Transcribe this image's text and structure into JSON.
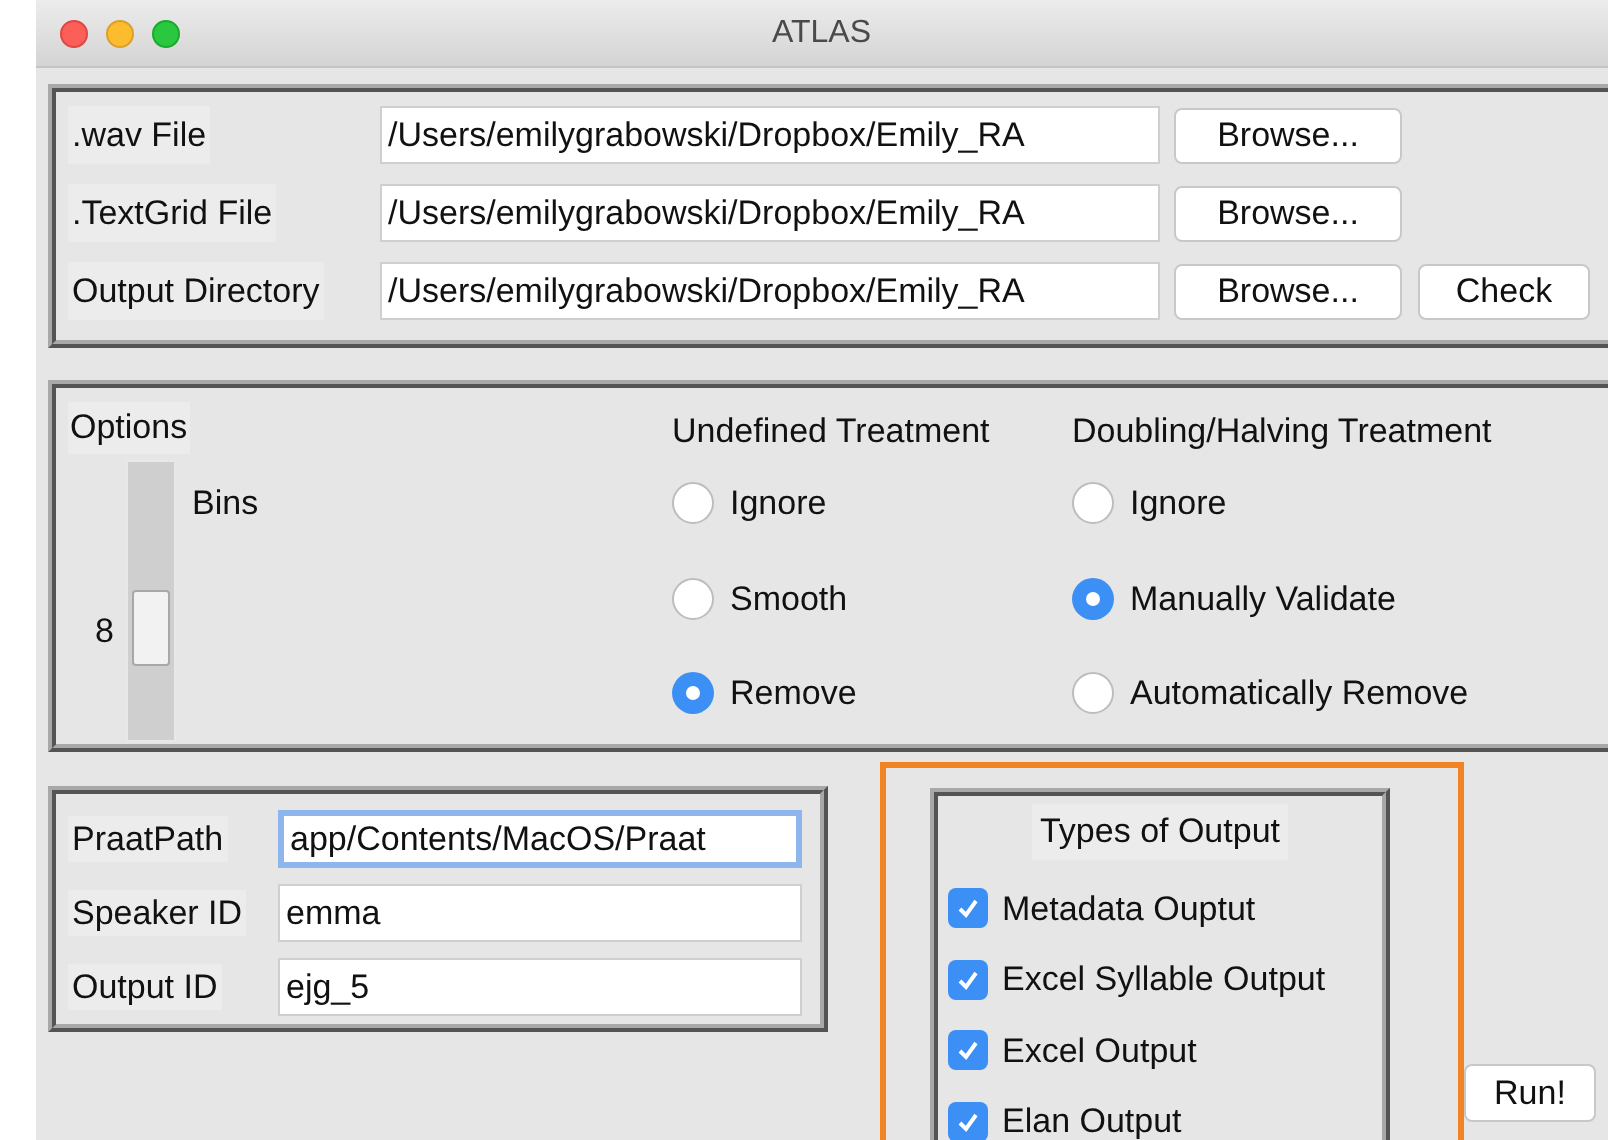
{
  "window": {
    "title": "ATLAS"
  },
  "files": [
    {
      "label": ".wav File",
      "value": "/Users/emilygrabowski/Dropbox/Emily_RA",
      "buttons": [
        "Browse..."
      ]
    },
    {
      "label": ".TextGrid File",
      "value": "/Users/emilygrabowski/Dropbox/Emily_RA",
      "buttons": [
        "Browse..."
      ]
    },
    {
      "label": "Output Directory",
      "value": "/Users/emilygrabowski/Dropbox/Emily_RA",
      "buttons": [
        "Browse...",
        "Check"
      ]
    }
  ],
  "options": {
    "title": "Options",
    "bins": {
      "label": "Bins",
      "reading": "8",
      "level": 0.63
    },
    "groups": [
      {
        "title": "Undefined Treatment",
        "choices": [
          {
            "label": "Ignore",
            "selected": false
          },
          {
            "label": "Smooth",
            "selected": false
          },
          {
            "label": "Remove",
            "selected": true
          }
        ]
      },
      {
        "title": "Doubling/Halving Treatment",
        "choices": [
          {
            "label": "Ignore",
            "selected": false
          },
          {
            "label": "Manually Validate",
            "selected": true
          },
          {
            "label": "Automatically Remove",
            "selected": false
          }
        ]
      }
    ]
  },
  "ids": [
    {
      "label": "PraatPath",
      "value": "app/Contents/MacOS/Praat",
      "focused": true
    },
    {
      "label": "Speaker ID",
      "value": "emma",
      "focused": false
    },
    {
      "label": "Output ID",
      "value": "ejg_5",
      "focused": false
    }
  ],
  "outputs": {
    "title": "Types of Output",
    "highlighted": true,
    "items": [
      {
        "label": "Metadata Ouptut",
        "checked": true
      },
      {
        "label": "Excel Syllable Output",
        "checked": true
      },
      {
        "label": "Excel Output",
        "checked": true
      },
      {
        "label": "Elan Output",
        "checked": true
      }
    ]
  },
  "run_button": "Run!"
}
